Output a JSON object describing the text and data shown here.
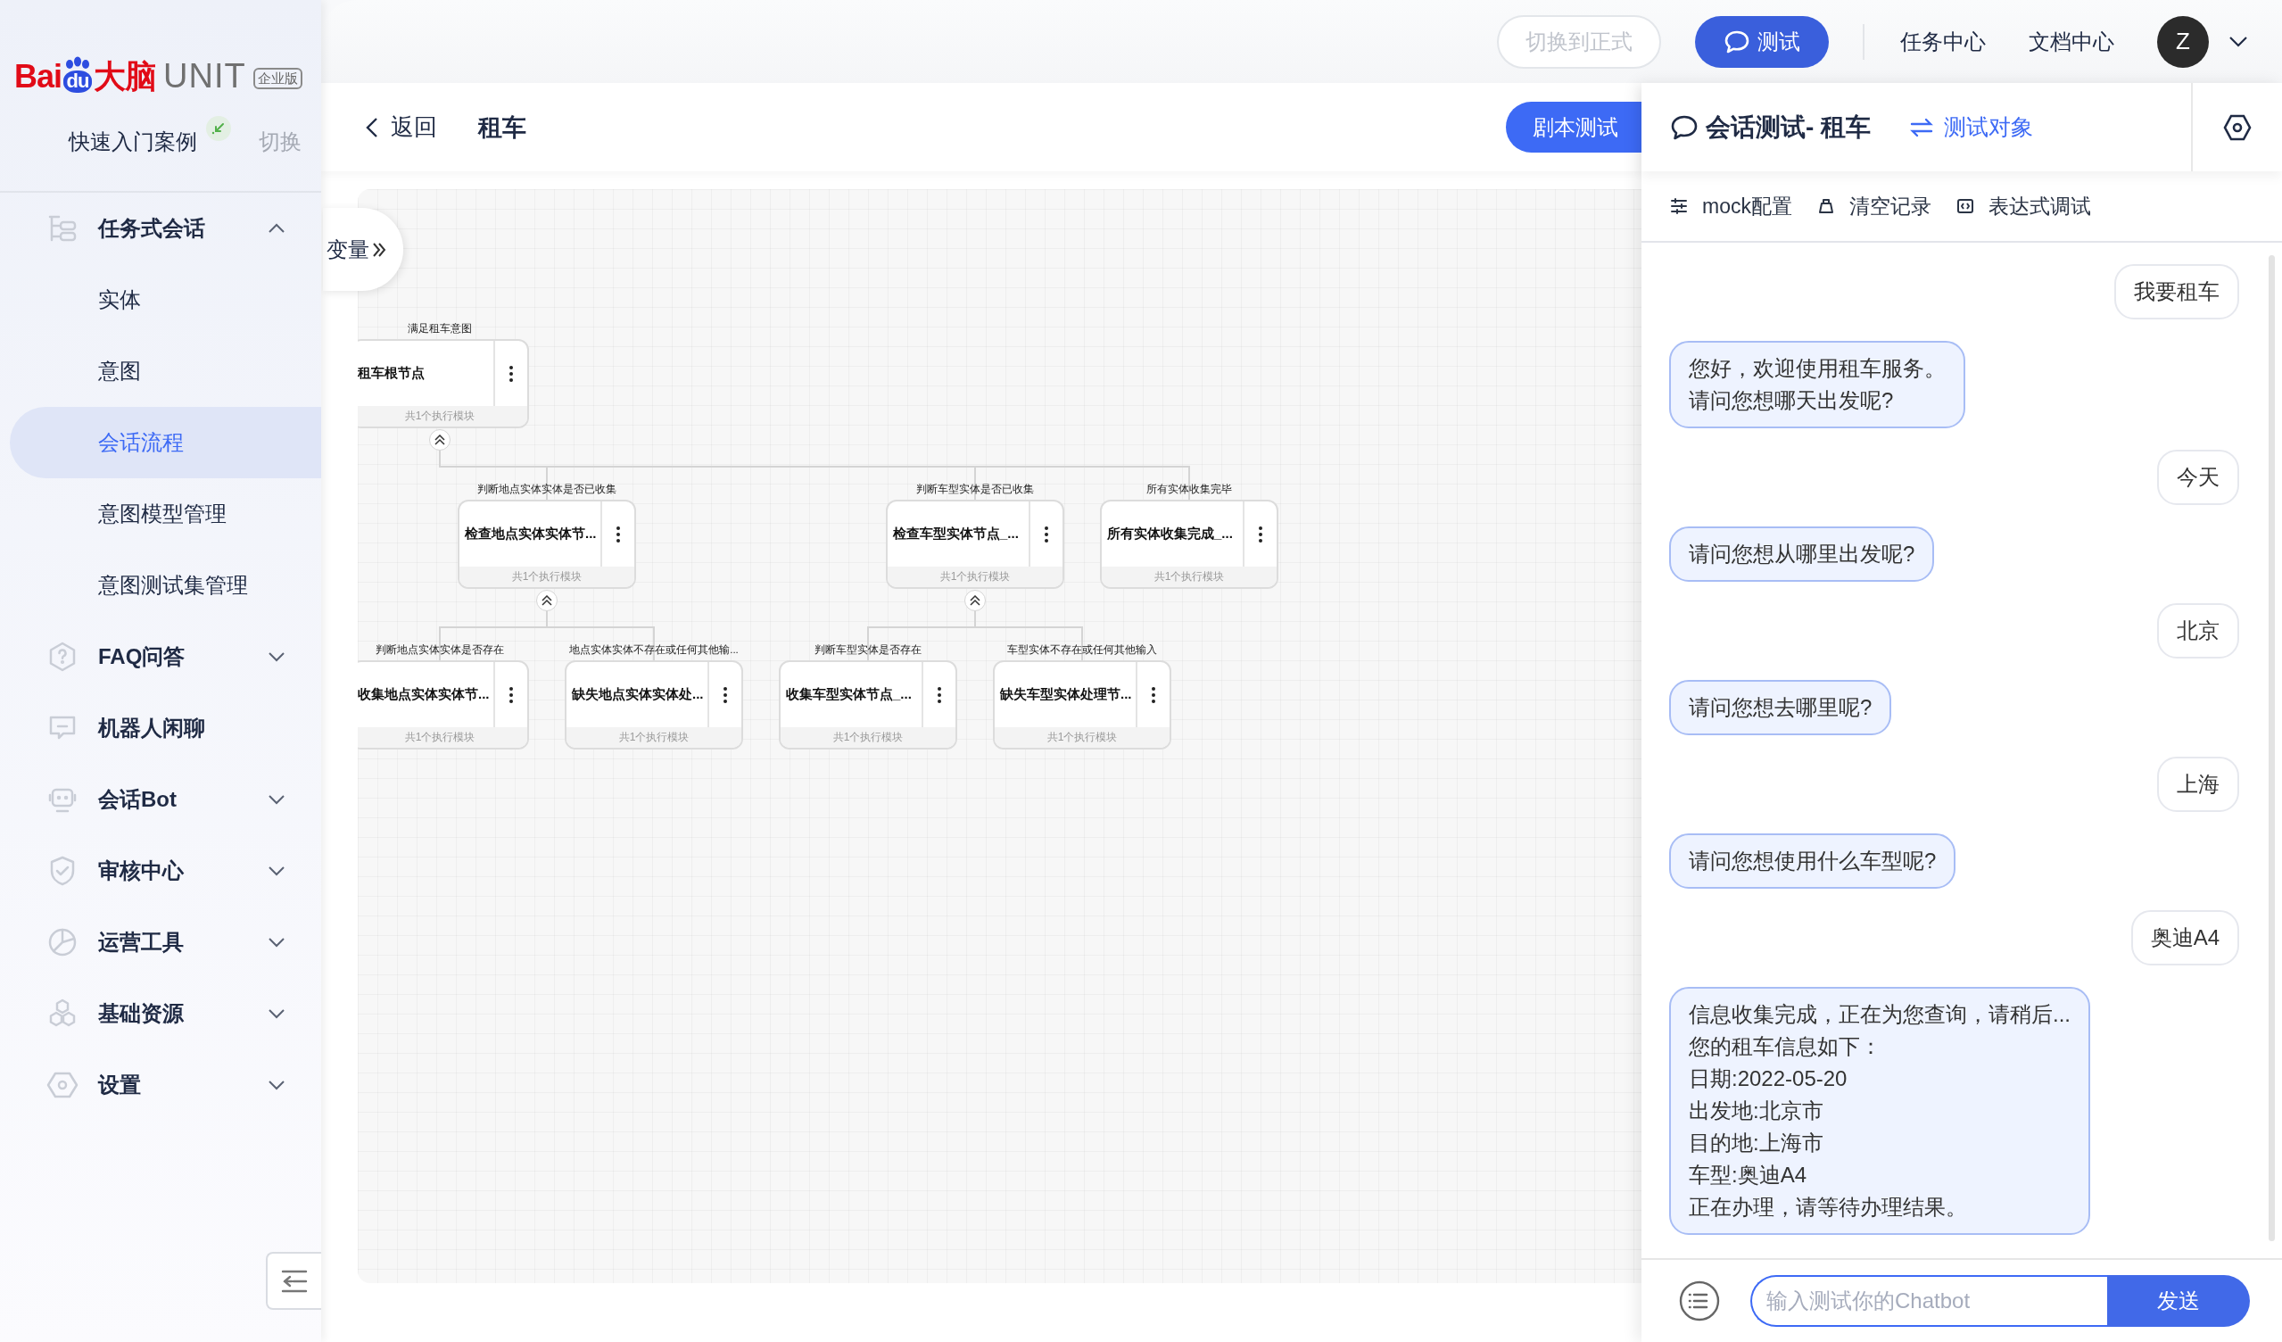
{
  "sidebar": {
    "logo": {
      "brand": "Bai",
      "paw": "du",
      "suffix": "大脑",
      "product": "UNIT",
      "edition": "企业版"
    },
    "case": {
      "label": "快速入门案例",
      "switch": "切换"
    },
    "items": [
      {
        "kind": "group",
        "label": "任务式会话",
        "expanded": true,
        "children": [
          {
            "label": "实体",
            "selected": false
          },
          {
            "label": "意图",
            "selected": false
          },
          {
            "label": "会话流程",
            "selected": true
          },
          {
            "label": "意图模型管理",
            "selected": false
          },
          {
            "label": "意图测试集管理",
            "selected": false
          }
        ]
      },
      {
        "kind": "group",
        "label": "FAQ问答",
        "expanded": false
      },
      {
        "kind": "link",
        "label": "机器人闲聊"
      },
      {
        "kind": "group",
        "label": "会话Bot",
        "expanded": false
      },
      {
        "kind": "group",
        "label": "审核中心",
        "expanded": false
      },
      {
        "kind": "group",
        "label": "运营工具",
        "expanded": false
      },
      {
        "kind": "group",
        "label": "基础资源",
        "expanded": false
      },
      {
        "kind": "group",
        "label": "设置",
        "expanded": false
      }
    ]
  },
  "top_bar": {
    "env_button": {
      "label": "切换到正式",
      "disabled": true
    },
    "test_button": {
      "label": "测试"
    },
    "links": [
      "任务中心",
      "文档中心"
    ],
    "avatar": {
      "initial": "Z"
    }
  },
  "editor": {
    "back": "返回",
    "title": "租车",
    "script_test_button": "剧本测试",
    "variables_tab": "变量",
    "flow": {
      "condition": "满足租车意图",
      "title": "租车根节点",
      "footer": "共1个执行模块",
      "expanded": true,
      "children": [
        {
          "condition": "判断地点实体实体是否已收集",
          "title": "检查地点实体实体节...",
          "footer": "共1个执行模块",
          "expanded": true,
          "children": [
            {
              "condition": "判断地点实体实体是否存在",
              "title": "收集地点实体实体节...",
              "footer": "共1个执行模块"
            },
            {
              "condition": "地点实体实体不存在或任何其他输...",
              "title": "缺失地点实体实体处...",
              "footer": "共1个执行模块"
            }
          ]
        },
        {
          "condition": "判断车型实体是否已收集",
          "title": "检查车型实体节点_...",
          "footer": "共1个执行模块",
          "expanded": true,
          "children": [
            {
              "condition": "判断车型实体是否存在",
              "title": "收集车型实体节点_...",
              "footer": "共1个执行模块"
            },
            {
              "condition": "车型实体不存在或任何其他输入",
              "title": "缺失车型实体处理节...",
              "footer": "共1个执行模块"
            }
          ]
        },
        {
          "condition": "所有实体收集完毕",
          "title": "所有实体收集完成_...",
          "footer": "共1个执行模块"
        }
      ]
    }
  },
  "chat": {
    "title": "会话测试- 租车",
    "target_link": "测试对象",
    "toolbar": [
      "mock配置",
      "清空记录",
      "表达式调试"
    ],
    "messages": [
      {
        "kind": "user",
        "lines": [
          "我要租车"
        ]
      },
      {
        "kind": "bot",
        "lines": [
          "您好，欢迎使用租车服务。",
          "请问您想哪天出发呢?"
        ]
      },
      {
        "kind": "user",
        "lines": [
          "今天"
        ]
      },
      {
        "kind": "bot",
        "lines": [
          "请问您想从哪里出发呢?"
        ]
      },
      {
        "kind": "user",
        "lines": [
          "北京"
        ]
      },
      {
        "kind": "bot",
        "lines": [
          "请问您想去哪里呢?"
        ]
      },
      {
        "kind": "user",
        "lines": [
          "上海"
        ]
      },
      {
        "kind": "bot",
        "lines": [
          "请问您想使用什么车型呢?"
        ]
      },
      {
        "kind": "user",
        "lines": [
          "奥迪A4"
        ]
      },
      {
        "kind": "bot",
        "lines": [
          "信息收集完成，正在为您查询，请稍后...",
          "您的租车信息如下：",
          "日期:2022-05-20",
          "出发地:北京市",
          "目的地:上海市",
          "车型:奥迪A4",
          "正在办理，请等待办理结果。"
        ]
      }
    ],
    "input": {
      "placeholder": "输入测试你的Chatbot"
    },
    "send_button": "发送"
  }
}
